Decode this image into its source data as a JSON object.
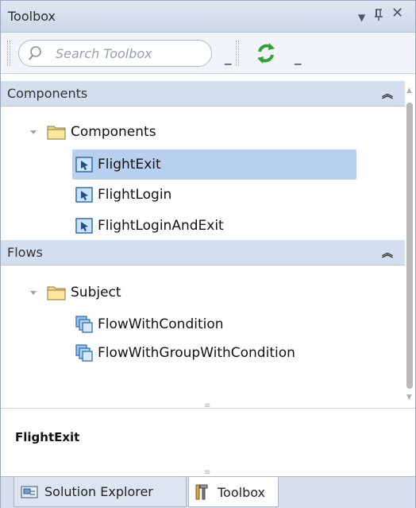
{
  "window": {
    "title": "Toolbox",
    "menu_icon": "dropdown-triangle-icon",
    "pin_icon": "pin-icon",
    "close_icon": "close-icon"
  },
  "toolbar": {
    "search_placeholder": "Search Toolbox",
    "refresh_icon": "refresh-icon"
  },
  "sections": [
    {
      "label": "Components",
      "folders": [
        {
          "label": "Components",
          "items": [
            {
              "label": "FlightExit",
              "selected": true,
              "icon": "component-icon"
            },
            {
              "label": "FlightLogin",
              "selected": false,
              "icon": "component-icon"
            },
            {
              "label": "FlightLoginAndExit",
              "selected": false,
              "icon": "component-icon"
            }
          ]
        }
      ]
    },
    {
      "label": "Flows",
      "folders": [
        {
          "label": "Subject",
          "items": [
            {
              "label": "FlowWithCondition",
              "selected": false,
              "icon": "flow-icon"
            },
            {
              "label": "FlowWithGroupWithCondition",
              "selected": false,
              "icon": "flow-icon"
            }
          ]
        }
      ]
    }
  ],
  "description": {
    "title": "FlightExit"
  },
  "tabs": [
    {
      "label": "Solution Explorer",
      "active": false,
      "icon": "solution-explorer-icon"
    },
    {
      "label": "Toolbox",
      "active": true,
      "icon": "toolbox-icon"
    }
  ],
  "colors": {
    "selection": "#b8cfee",
    "section_header": "#d3deef",
    "titlebar": "#ccd7e8"
  }
}
